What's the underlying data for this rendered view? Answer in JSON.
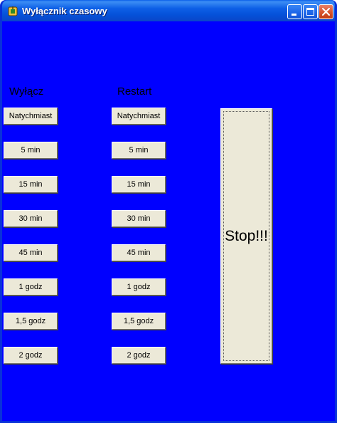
{
  "window": {
    "title": "Wyłącznik czasowy"
  },
  "columns": {
    "shutdown_label": "Wyłącz",
    "restart_label": "Restart"
  },
  "shutdown_buttons": [
    "Natychmiast",
    "5 min",
    "15 min",
    "30 min",
    "45 min",
    "1 godz",
    "1,5 godz",
    "2 godz"
  ],
  "restart_buttons": [
    "Natychmiast",
    "5 min",
    "15 min",
    "30 min",
    "45 min",
    "1 godz",
    "1,5 godz",
    "2 godz"
  ],
  "stop_button": "Stop!!!",
  "icons": {
    "app": "app-icon",
    "minimize": "minimize-icon",
    "maximize": "maximize-icon",
    "close": "close-icon"
  },
  "colors": {
    "client_background": "#0000ff",
    "button_face": "#ece9d8",
    "titlebar": "#0a5fe8"
  }
}
